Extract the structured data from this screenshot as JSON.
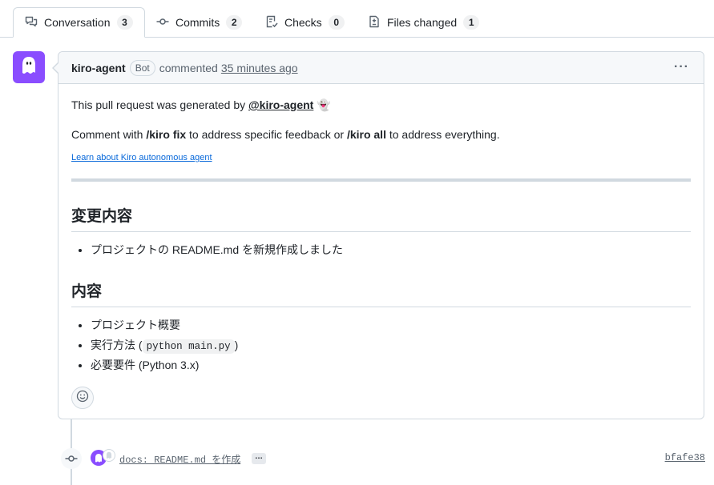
{
  "tabs": [
    {
      "label": "Conversation",
      "count": "3",
      "icon": "comment-discussion-icon"
    },
    {
      "label": "Commits",
      "count": "2",
      "icon": "git-commit-icon"
    },
    {
      "label": "Checks",
      "count": "0",
      "icon": "checklist-icon"
    },
    {
      "label": "Files changed",
      "count": "1",
      "icon": "file-diff-icon"
    }
  ],
  "comment": {
    "author": "kiro-agent",
    "author_badge": "Bot",
    "action": "commented",
    "time": "35 minutes ago",
    "menu": "···",
    "intro_prefix": "This pull request was generated by",
    "intro_mention": "@kiro-agent",
    "intro_emoji": "👻",
    "instr_1": "Comment with ",
    "instr_cmd_fix": "/kiro fix",
    "instr_2": " to address specific feedback or ",
    "instr_cmd_all": "/kiro all",
    "instr_3": " to address everything.",
    "learn_link": "Learn about Kiro autonomous agent",
    "section1_title": "変更内容",
    "section1_items": [
      "プロジェクトの README.md を新規作成しました"
    ],
    "section2_title": "内容",
    "section2_item1": "プロジェクト概要",
    "section2_item2_prefix": "実行方法 (",
    "section2_item2_code": "python main.py",
    "section2_item2_suffix": ")",
    "section2_item3": "必要要件 (Python 3.x)"
  },
  "commit": {
    "message": "docs: README.md を作成",
    "expand": "…",
    "sha": "bfafe38"
  },
  "colors": {
    "avatar_bg": "#8a4dff",
    "link": "#0969da",
    "border": "#d1d9e0",
    "header_bg": "#f6f8fa",
    "muted": "#59636e"
  }
}
